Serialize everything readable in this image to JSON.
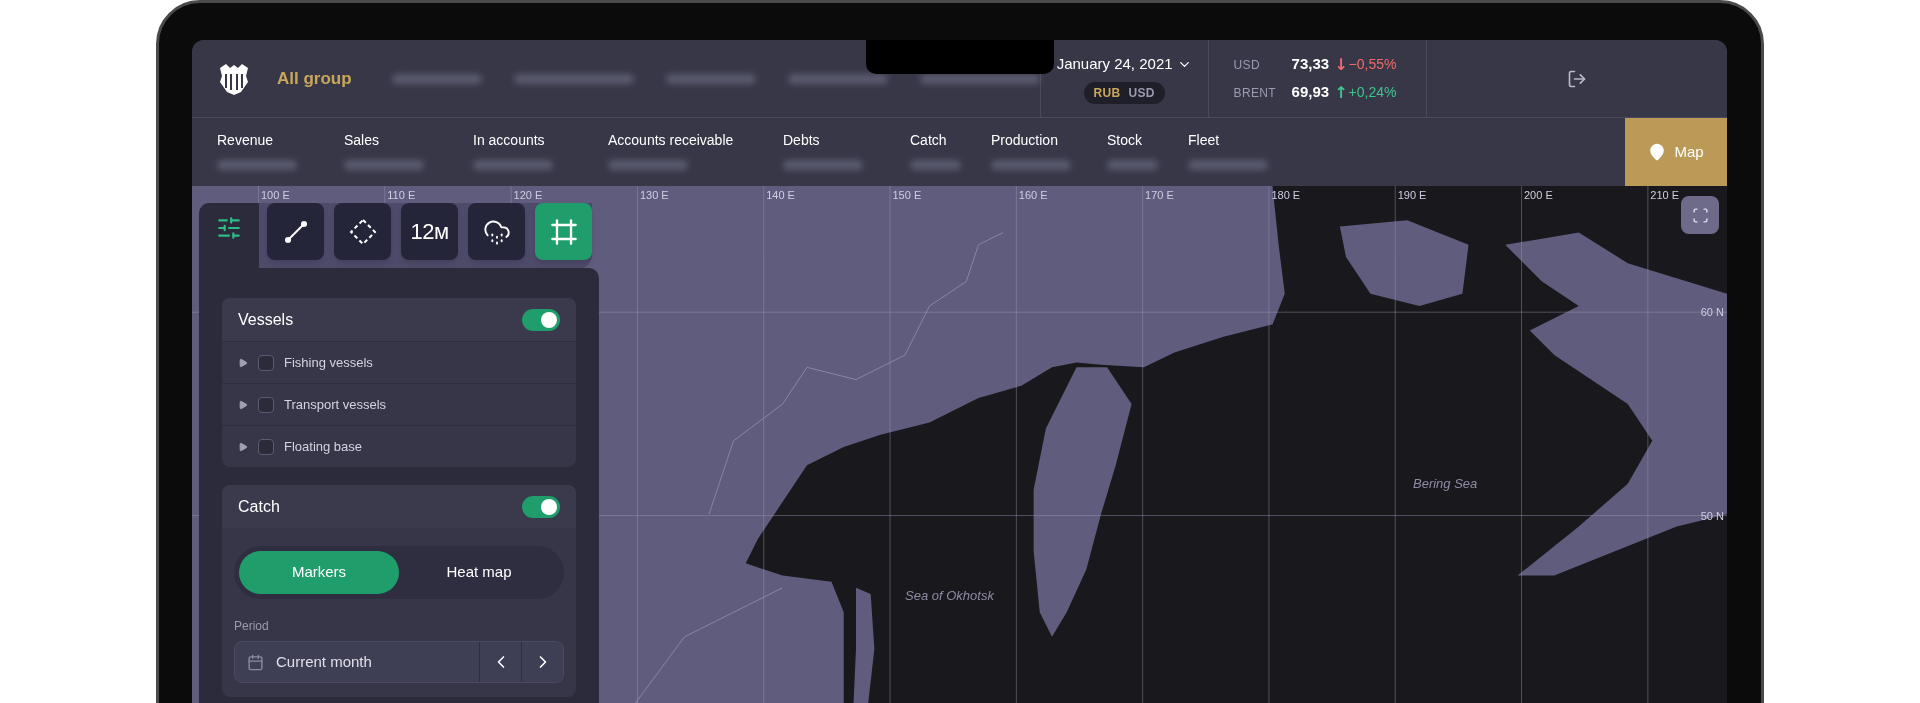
{
  "header": {
    "brand": "All group",
    "date": "January 24, 2021",
    "currency_toggle": [
      {
        "label": "RUB",
        "selected": true
      },
      {
        "label": "USD",
        "selected": false
      }
    ],
    "rates": [
      {
        "name": "USD",
        "value": "73,33",
        "color": "#ef6b6b",
        "arrow": "↓",
        "change": "−0,55%"
      },
      {
        "name": "BRENT",
        "value": "69,93",
        "color": "#3ec48c",
        "arrow": "↑",
        "change": "+0,24%"
      }
    ]
  },
  "metrics": [
    {
      "label": "Revenue"
    },
    {
      "label": "Sales"
    },
    {
      "label": "In accounts"
    },
    {
      "label": "Accounts receivable"
    },
    {
      "label": "Debts"
    },
    {
      "label": "Catch"
    },
    {
      "label": "Production"
    },
    {
      "label": "Stock"
    },
    {
      "label": "Fleet"
    }
  ],
  "map_button": {
    "label": "Map"
  },
  "tools": [
    {
      "kind": "line",
      "selected": false
    },
    {
      "kind": "polygon",
      "selected": false
    },
    {
      "kind": "distance",
      "label": "12м",
      "selected": false
    },
    {
      "kind": "weather",
      "selected": false
    },
    {
      "kind": "frame",
      "selected": true
    }
  ],
  "layers": [
    {
      "kind": "list",
      "title": "Vessels",
      "on": true,
      "items": [
        {
          "label": "Fishing vessels",
          "checked": false,
          "expanded": false
        },
        {
          "label": "Transport vessels",
          "checked": false,
          "expanded": false
        },
        {
          "label": "Floating base",
          "checked": false,
          "expanded": false
        }
      ]
    },
    {
      "kind": "catch",
      "title": "Catch",
      "on": true,
      "modes": [
        {
          "label": "Markers",
          "selected": true
        },
        {
          "label": "Heat map",
          "selected": false
        }
      ],
      "period": {
        "label": "Period",
        "value": "Current month"
      }
    }
  ],
  "map": {
    "longitude_labels": [
      "100 E",
      "110 E",
      "120 E",
      "130 E",
      "140 E",
      "150 E",
      "160 E",
      "170 E",
      "180 E",
      "190 E",
      "200 E",
      "210 E"
    ],
    "latitude_labels": [
      "60 N",
      "50 N"
    ],
    "place_labels": [
      {
        "label": "Sea of Okhotsk"
      },
      {
        "label": "Bering Sea"
      }
    ]
  }
}
